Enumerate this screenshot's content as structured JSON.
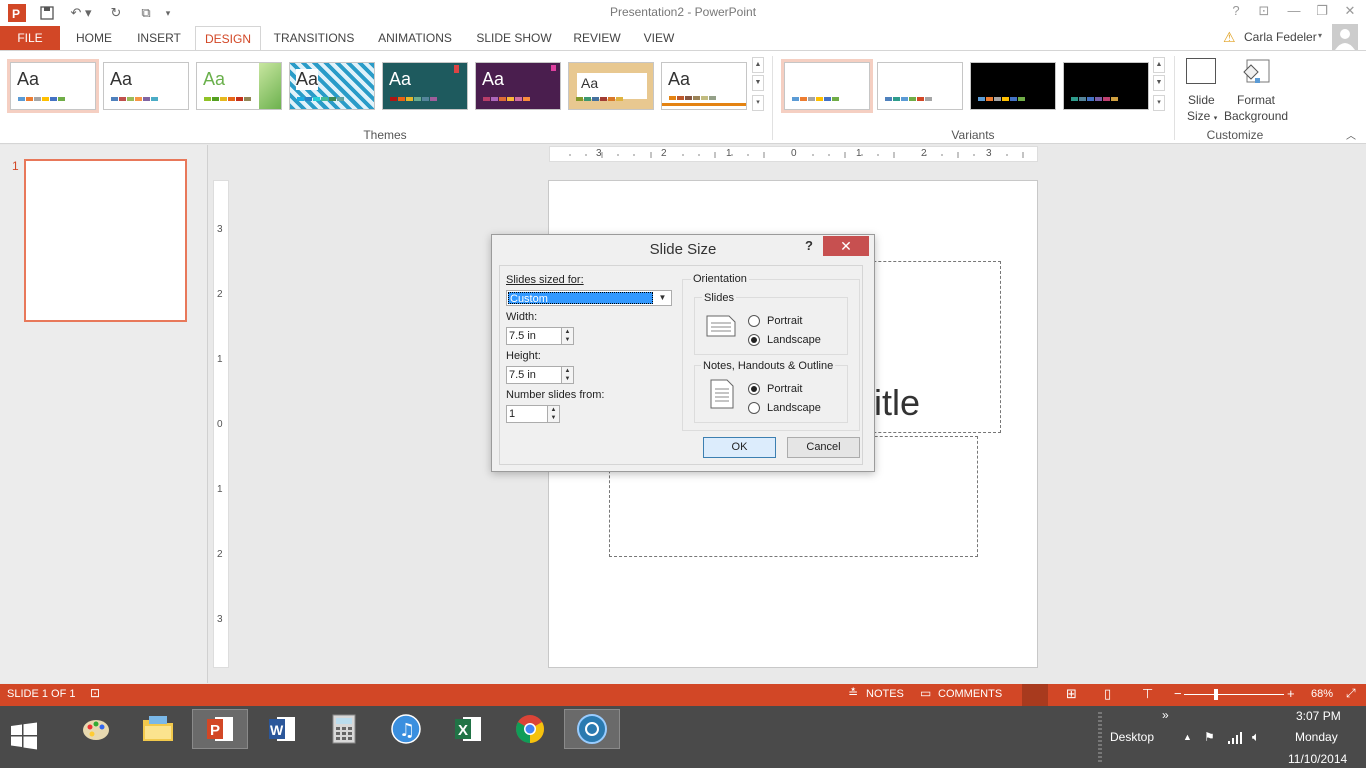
{
  "window": {
    "title": "Presentation2 - PowerPoint",
    "user": "Carla Fedeler"
  },
  "tabs": [
    "FILE",
    "HOME",
    "INSERT",
    "DESIGN",
    "TRANSITIONS",
    "ANIMATIONS",
    "SLIDE SHOW",
    "REVIEW",
    "VIEW"
  ],
  "ribbon": {
    "themes_label": "Themes",
    "variants_label": "Variants",
    "customize_label": "Customize",
    "theme_text": "Aa",
    "slide_size_label_1": "Slide",
    "slide_size_label_2": "Size",
    "format_bg_label_1": "Format",
    "format_bg_label_2": "Background"
  },
  "slides_pane": {
    "slide_number": "1"
  },
  "slide": {
    "title_fragment": "itle"
  },
  "rulers": {
    "horizontal": [
      "3",
      "2",
      "1",
      "0",
      "1",
      "2",
      "3"
    ],
    "vertical": [
      "3",
      "2",
      "1",
      "0",
      "1",
      "2",
      "3"
    ]
  },
  "dialog": {
    "title": "Slide Size",
    "help": "?",
    "close": "✕",
    "sized_for_label": "Slides sized for:",
    "sized_for_value": "Custom",
    "width_label": "Width:",
    "width_value": "7.5 in",
    "height_label": "Height:",
    "height_value": "7.5 in",
    "number_from_label": "Number slides from:",
    "number_from_value": "1",
    "orientation_label": "Orientation",
    "slides_group": "Slides",
    "slides_portrait": "Portrait",
    "slides_landscape": "Landscape",
    "notes_group": "Notes, Handouts & Outline",
    "notes_portrait": "Portrait",
    "notes_landscape": "Landscape",
    "ok": "OK",
    "cancel": "Cancel"
  },
  "statusbar": {
    "slide_count": "SLIDE 1 OF 1",
    "notes": "NOTES",
    "comments": "COMMENTS",
    "zoom": "68%"
  },
  "taskbar": {
    "desktop": "Desktop",
    "time": "3:07 PM",
    "day": "Monday",
    "date": "11/10/2014"
  },
  "colors": {
    "accent": "#d24726",
    "close": "#c75050"
  }
}
